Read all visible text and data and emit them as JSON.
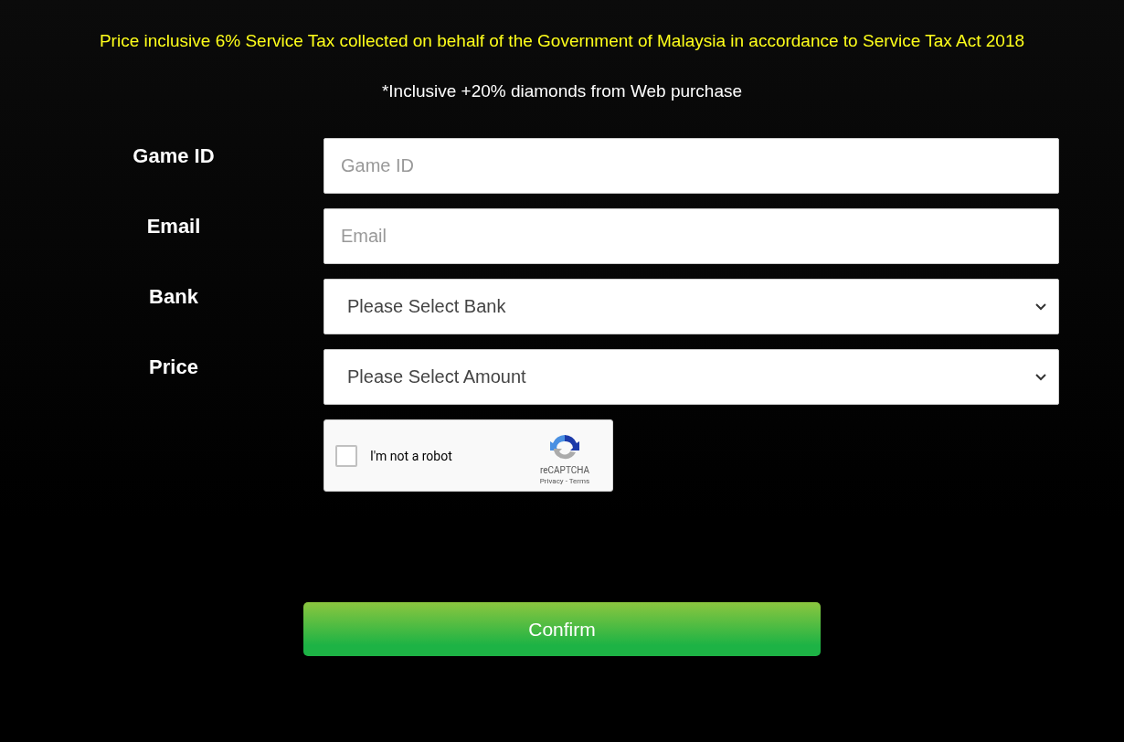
{
  "notice": "Price inclusive 6% Service Tax collected on behalf of the Government of Malaysia in accordance to Service Tax Act 2018",
  "subnote": "*Inclusive +20% diamonds from Web purchase",
  "fields": [
    {
      "label": "Game ID",
      "kind": "input",
      "placeholder": "Game ID"
    },
    {
      "label": "Email",
      "kind": "input",
      "placeholder": "Email"
    },
    {
      "label": "Bank",
      "kind": "select",
      "value": "Please Select Bank"
    },
    {
      "label": "Price",
      "kind": "select",
      "value": "Please Select Amount"
    }
  ],
  "captcha": {
    "label": "I'm not a robot",
    "checked": false,
    "brand": "reCAPTCHA",
    "privacy": "Privacy",
    "separator": "-",
    "terms": "Terms"
  },
  "confirm": "Confirm"
}
